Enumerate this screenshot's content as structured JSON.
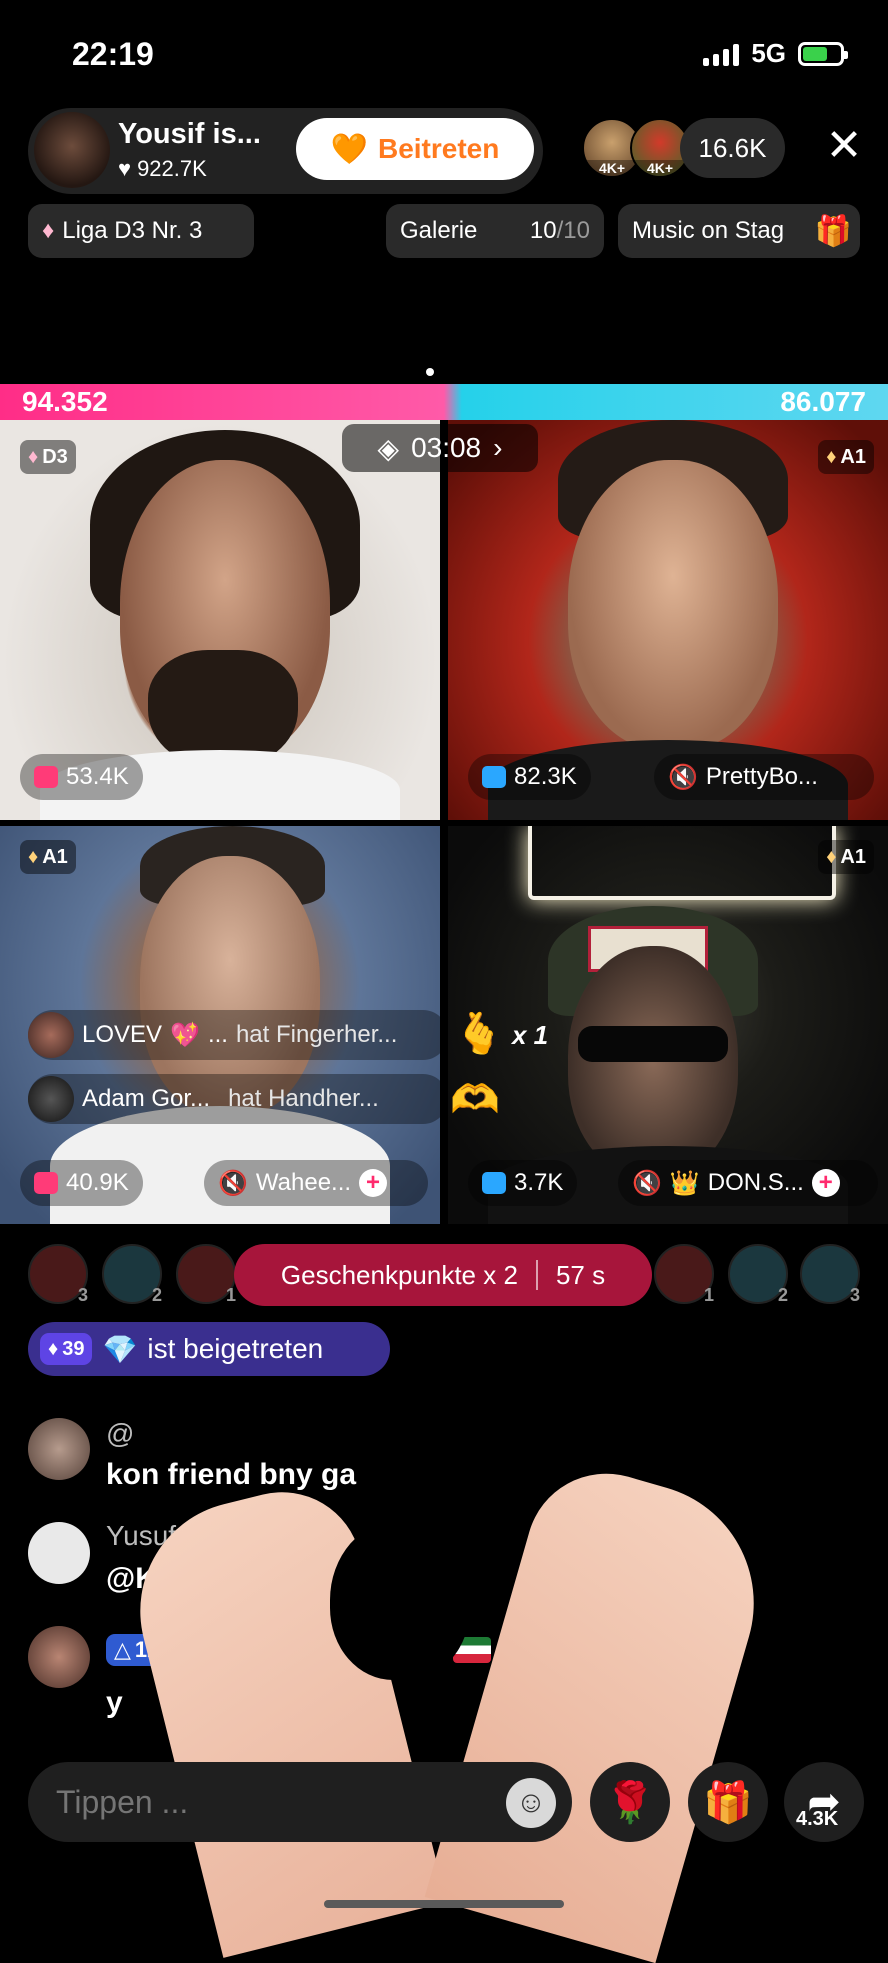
{
  "status_bar": {
    "time": "22:19",
    "network": "5G"
  },
  "host": {
    "name": "Yousif is...",
    "likes": "922.7K",
    "join_label": "Beitreten"
  },
  "viewers": {
    "badge_1": "4K+",
    "badge_2": "4K+",
    "count": "16.6K"
  },
  "league": {
    "label": "Liga D3 Nr. 3"
  },
  "gallery": {
    "label": "Galerie",
    "current": "10",
    "total": "/10"
  },
  "music": {
    "label": "Music on Stag"
  },
  "battle": {
    "score_left": "94.352",
    "score_right": "86.077",
    "timer": "03:08"
  },
  "tiles": [
    {
      "tier": "D3",
      "stat": "53.4K",
      "stat_color": "#ff3b78"
    },
    {
      "tier": "A1",
      "stat": "82.3K",
      "stat_color": "#2aa7ff",
      "name": "PrettyBo..."
    },
    {
      "tier": "A1",
      "stat": "40.9K",
      "stat_color": "#ff3b78",
      "name": "Wahee..."
    },
    {
      "tier": "A1",
      "stat": "3.7K",
      "stat_color": "#2aa7ff",
      "name": "DON.S..."
    }
  ],
  "gifts": [
    {
      "user": "LOVEV",
      "action": "hat Fingerher...",
      "multiplier": "x 1"
    },
    {
      "user": "Adam Gor...",
      "action": "hat Handher..."
    }
  ],
  "ranking": {
    "left": [
      "3",
      "2",
      "1"
    ],
    "right": [
      "1",
      "2",
      "3"
    ],
    "points_label": "Geschenkpunkte x 2",
    "points_time": "57 s"
  },
  "joined": {
    "level": "39",
    "text": "ist beigetreten"
  },
  "chat": [
    {
      "name": "@",
      "text": "kon friend bny ga"
    },
    {
      "name": "Yusuf is he",
      "text": "@King L      k"
    },
    {
      "level": "12",
      "text": "y"
    }
  ],
  "bottom": {
    "placeholder": "Tippen ...",
    "share_count": "4.3K"
  },
  "colors": {
    "accent_pink": "#ff2d87",
    "accent_cyan": "#25d1ea",
    "join_orange": "#ff7a1f",
    "points_red": "#a7153b",
    "joined_purple": "#3a2f8f"
  }
}
